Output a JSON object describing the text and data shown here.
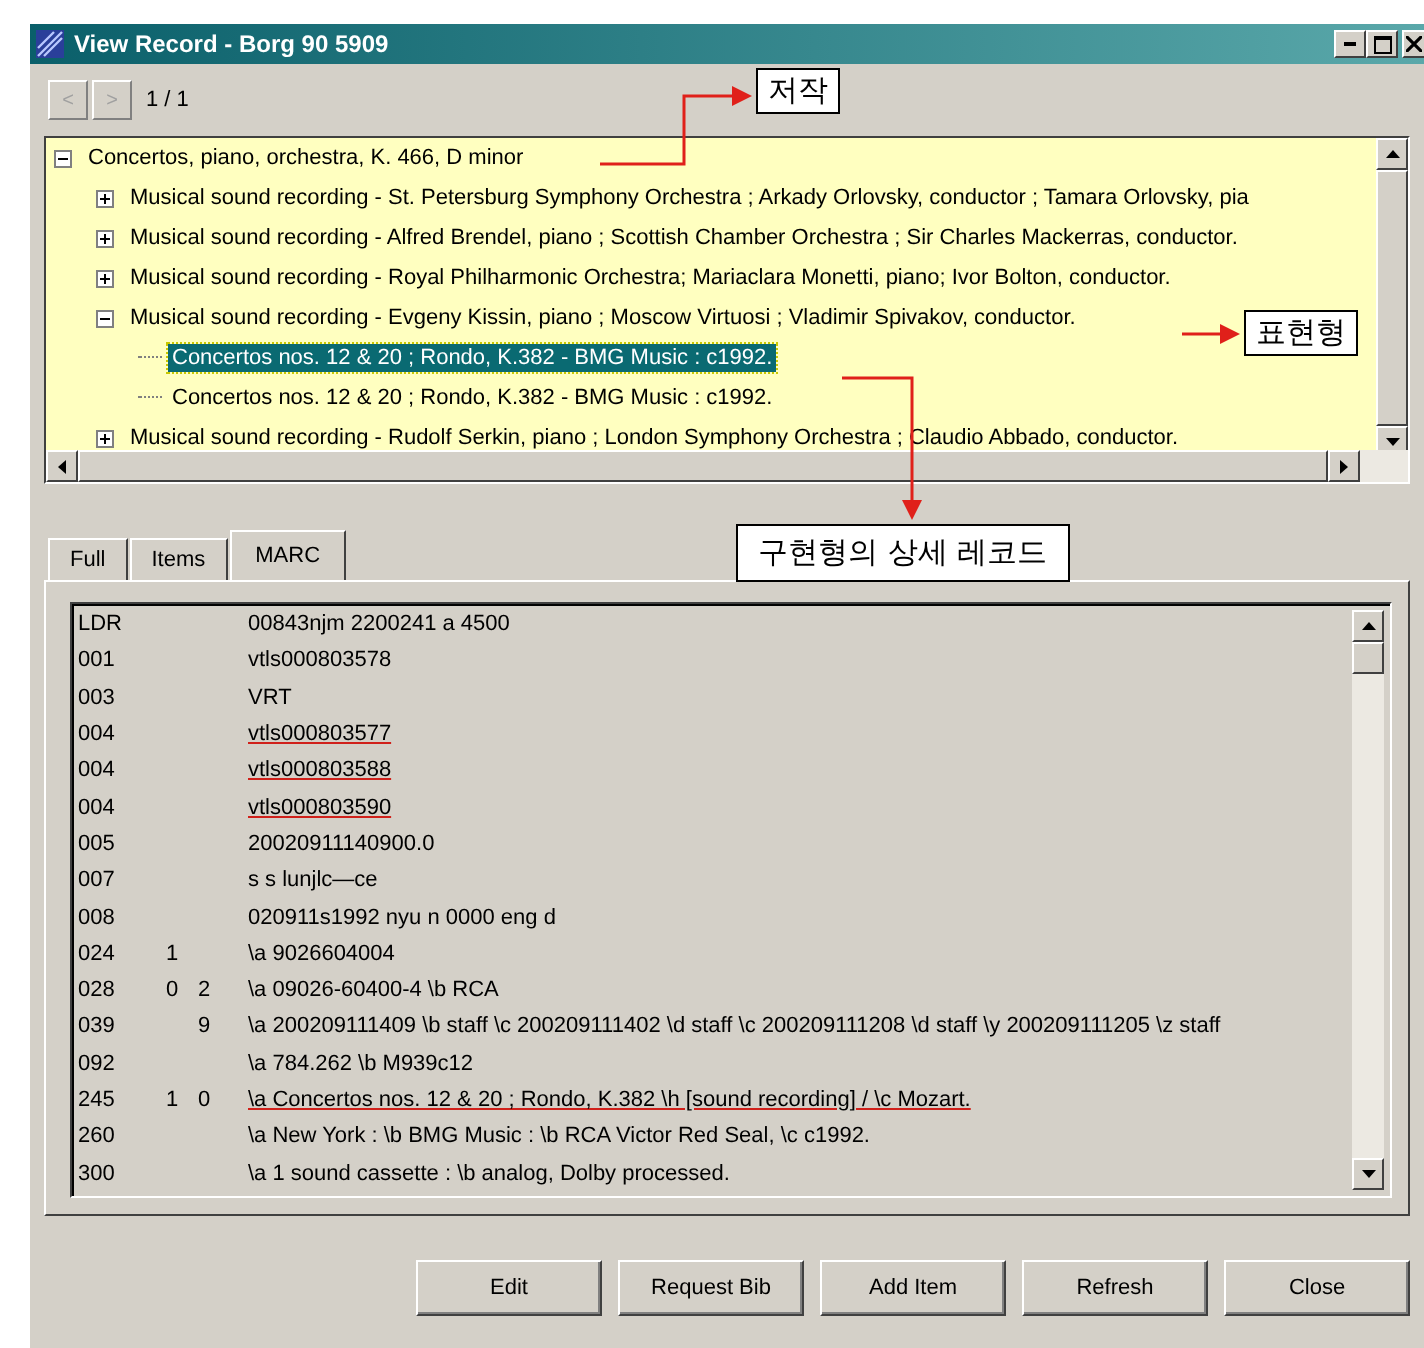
{
  "window": {
    "title": "View Record - Borg 90 5909"
  },
  "nav": {
    "prev": "<",
    "next": ">",
    "position": "1 / 1"
  },
  "tree": [
    {
      "label": "Concertos, piano, orchestra, K. 466, D minor",
      "expanded": true,
      "selected": false,
      "children": [
        {
          "label": "Musical sound recording - St. Petersburg Symphony Orchestra ; Arkady Orlovsky, conductor ; Tamara Orlovsky, pia",
          "expanded": false,
          "selected": false
        },
        {
          "label": "Musical sound recording - Alfred Brendel, piano ; Scottish Chamber Orchestra ; Sir Charles Mackerras, conductor.",
          "expanded": false,
          "selected": false
        },
        {
          "label": "Musical sound recording - Royal Philharmonic Orchestra; Mariaclara Monetti, piano; Ivor Bolton, conductor.",
          "expanded": false,
          "selected": false
        },
        {
          "label": "Musical sound recording - Evgeny Kissin, piano ; Moscow Virtuosi ; Vladimir Spivakov, conductor.",
          "expanded": true,
          "selected": false,
          "children": [
            {
              "label": "Concertos nos. 12 & 20 ; Rondo, K.382 - BMG Music : c1992.",
              "selected": true
            },
            {
              "label": "Concertos nos. 12 & 20 ; Rondo, K.382 - BMG Music : c1992.",
              "selected": false
            }
          ]
        },
        {
          "label": "Musical sound recording - Rudolf Serkin, piano ; London Symphony Orchestra ; Claudio Abbado, conductor.",
          "expanded": false,
          "selected": false
        }
      ]
    }
  ],
  "tabs": [
    {
      "label": "Full",
      "selected": false
    },
    {
      "label": "Items",
      "selected": false
    },
    {
      "label": "MARC",
      "selected": true
    }
  ],
  "marc": [
    {
      "tag": "LDR",
      "value": "00843njm  2200241 a 4500",
      "underlined": false
    },
    {
      "tag": "001",
      "value": "vtls000803578",
      "underlined": false
    },
    {
      "tag": "003",
      "value": "VRT",
      "underlined": false
    },
    {
      "tag": "004",
      "value": "vtls000803577",
      "underlined": true
    },
    {
      "tag": "004",
      "value": "vtls000803588",
      "underlined": true
    },
    {
      "tag": "004",
      "value": "vtls000803590",
      "underlined": true
    },
    {
      "tag": "005",
      "value": "20020911140900.0",
      "underlined": false
    },
    {
      "tag": "007",
      "value": "s s lunjlc—ce",
      "underlined": false
    },
    {
      "tag": "008",
      "value": "020911s1992    nyu  n        0000  eng d",
      "underlined": false
    },
    {
      "tag": "024",
      "ind1": "1",
      "value": "\\a 9026604004",
      "underlined": false
    },
    {
      "tag": "028",
      "ind1": "0",
      "ind2": "2",
      "value": "\\a 09026-60400-4 \\b RCA",
      "underlined": false
    },
    {
      "tag": "039",
      "ind2": "9",
      "value": "\\a 200209111409 \\b staff \\c 200209111402 \\d staff \\c 200209111208 \\d staff \\y 200209111205 \\z staff",
      "underlined": false
    },
    {
      "tag": "092",
      "value": "\\a 784.262 \\b M939c12",
      "underlined": false
    },
    {
      "tag": "245",
      "ind1": "1",
      "ind2": "0",
      "value": "\\a Concertos nos. 12 & 20 ; Rondo, K.382 \\h [sound recording] / \\c Mozart.",
      "underlined": true
    },
    {
      "tag": "260",
      "value": "\\a New York : \\b BMG Music : \\b RCA Victor Red Seal, \\c c1992.",
      "underlined": false
    },
    {
      "tag": "300",
      "value": "\\a 1 sound cassette : \\b analog, Dolby processed.",
      "underlined": false
    }
  ],
  "buttons": [
    "Edit",
    "Request Bib",
    "Add Item",
    "Refresh",
    "Close"
  ],
  "annotations": [
    {
      "kind": "work",
      "text": "저작"
    },
    {
      "kind": "expression",
      "text": "표현형"
    },
    {
      "kind": "manifestation",
      "text": "구현형의 상세 레코드"
    }
  ]
}
